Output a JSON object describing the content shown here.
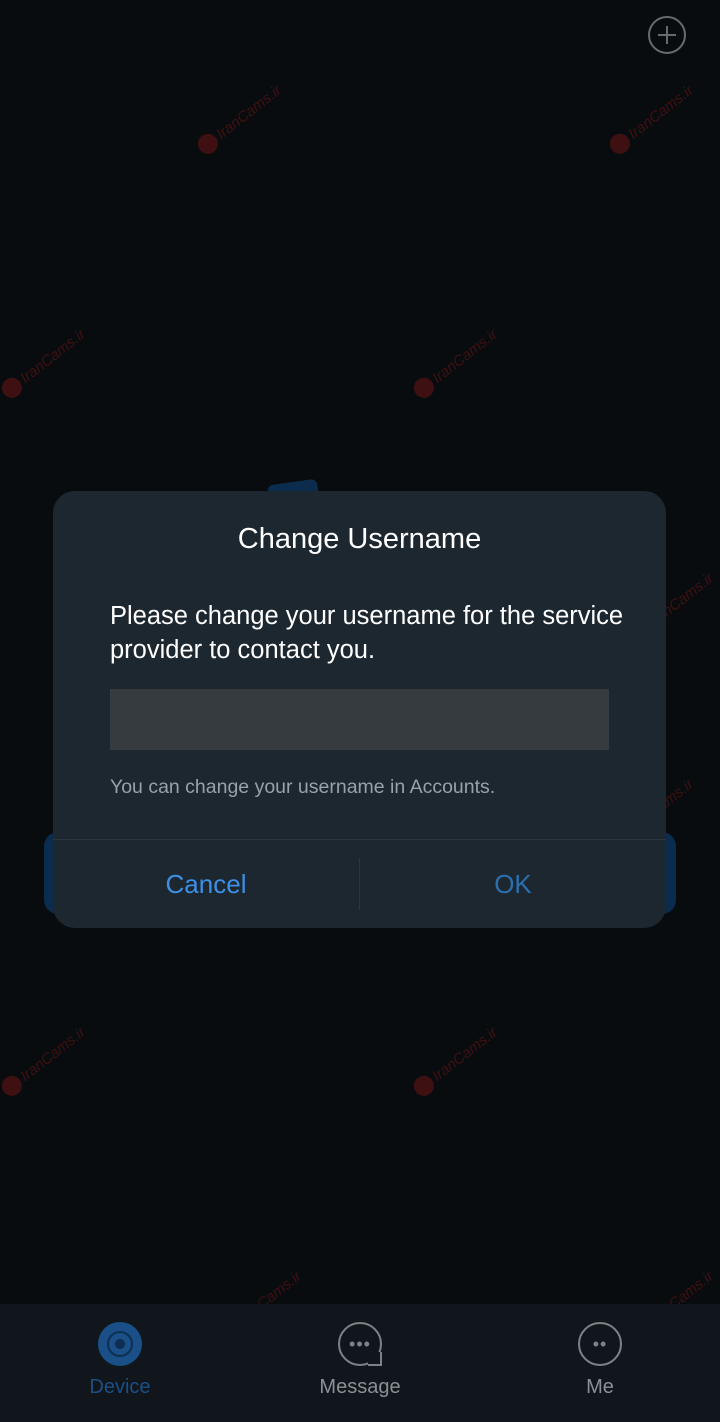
{
  "dialog": {
    "title": "Change Username",
    "message": "Please change your username for the service provider to contact you.",
    "input_value": "",
    "hint": "You can change your username in Accounts.",
    "cancel_label": "Cancel",
    "ok_label": "OK"
  },
  "tabs": [
    {
      "label": "Device",
      "icon": "camera-icon",
      "active": true
    },
    {
      "label": "Message",
      "icon": "chat-bubble-icon",
      "active": false
    },
    {
      "label": "Me",
      "icon": "profile-icon",
      "active": false
    }
  ],
  "watermark": "IranCams.ir",
  "colors": {
    "accent": "#3d8fe6",
    "active_tab": "#1a4f87",
    "dialog_bg": "#1d2730",
    "watermark": "#aa1e1e"
  }
}
